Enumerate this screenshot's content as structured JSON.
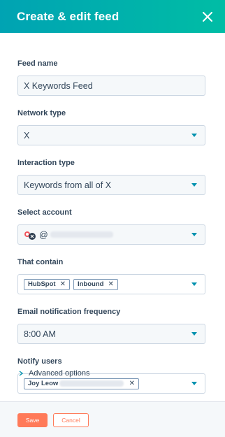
{
  "header": {
    "title": "Create & edit feed",
    "close_icon": "close-icon"
  },
  "form": {
    "feed_name": {
      "label": "Feed name",
      "value": "X Keywords Feed"
    },
    "network_type": {
      "label": "Network type",
      "value": "X"
    },
    "interaction_type": {
      "label": "Interaction type",
      "value": "Keywords from all of X"
    },
    "select_account": {
      "label": "Select account",
      "handle_prefix": "@"
    },
    "that_contain": {
      "label": "That contain",
      "tags": [
        "HubSpot",
        "Inbound"
      ]
    },
    "email_frequency": {
      "label": "Email notification frequency",
      "value": "8:00 AM"
    },
    "notify_users": {
      "label": "Notify users",
      "user_name": "Joy Leow"
    }
  },
  "advanced": {
    "label": "Advanced options"
  },
  "footer": {
    "save_label": "Save",
    "cancel_label": "Cancel"
  },
  "colors": {
    "accent": "#00bda5",
    "primary": "#ff7a59",
    "link": "#0091ae"
  }
}
